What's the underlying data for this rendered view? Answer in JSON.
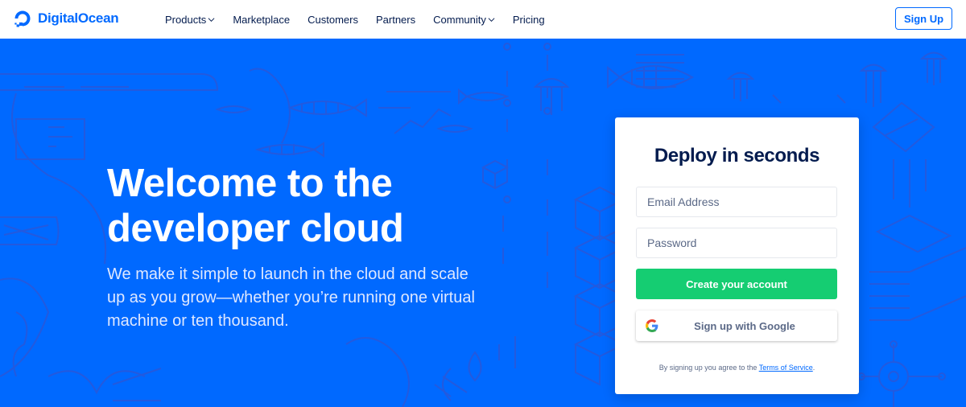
{
  "nav": {
    "brand": "DigitalOcean",
    "items": [
      {
        "label": "Products",
        "dropdown": true
      },
      {
        "label": "Marketplace",
        "dropdown": false
      },
      {
        "label": "Customers",
        "dropdown": false
      },
      {
        "label": "Partners",
        "dropdown": false
      },
      {
        "label": "Community",
        "dropdown": true
      },
      {
        "label": "Pricing",
        "dropdown": false
      }
    ],
    "signup_label": "Sign Up"
  },
  "hero": {
    "headline_line1": "Welcome to the",
    "headline_line2": "developer cloud",
    "subtext": "We make it simple to launch in the cloud and scale up as you grow—whether you’re running one virtual machine or ten thousand."
  },
  "signup_card": {
    "title": "Deploy in seconds",
    "email_placeholder": "Email Address",
    "email_value": "",
    "password_placeholder": "Password",
    "password_value": "",
    "create_label": "Create your account",
    "google_label": "Sign up with Google",
    "terms_prefix": "By signing up you agree to the ",
    "terms_link": "Terms of Service",
    "terms_suffix": "."
  },
  "icons": {
    "logo": "digitalocean-logo-icon",
    "dropdown": "chevron-down-icon",
    "google": "google-icon"
  },
  "colors": {
    "brand_blue": "#0069ff",
    "nav_text": "#031b4e",
    "create_green": "#15cd72",
    "muted_text": "#5b6987"
  }
}
